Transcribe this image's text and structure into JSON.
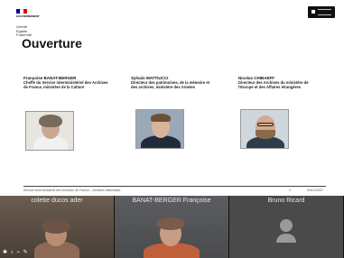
{
  "slide": {
    "logo_lines": [
      "GOUVERNEMENT"
    ],
    "logo_small": [
      "Liberté",
      "Égalité",
      "Fraternité"
    ],
    "title": "Ouverture",
    "speakers": [
      {
        "name": "Françoise BANAT-BERGER",
        "role": "Cheffe du Service interministériel des Archives de France, ministère de la Culture"
      },
      {
        "name": "Sylvain MATTIUCCI",
        "role": "Directeur des patrimoines, de la mémoire et des archives, ministère des Armées"
      },
      {
        "name": "Nicolas CHIBAEFF",
        "role": "Directeur des Archives du ministère de l'Europe et des Affaires étrangères"
      }
    ],
    "footer_text": "Service interministériel des Archives de France – Archives Nationales",
    "footer_page": "2",
    "footer_date": "04/12/2020"
  },
  "participants": [
    {
      "name": "colette ducos ader"
    },
    {
      "name": "BANAT-BERGER Françoise"
    },
    {
      "name": "Bruno Ricard"
    }
  ],
  "status_icons": "✱ ♪ ⌁ ✎",
  "colors": {
    "marianne_blue": "#000091",
    "marianne_red": "#e1000f"
  }
}
